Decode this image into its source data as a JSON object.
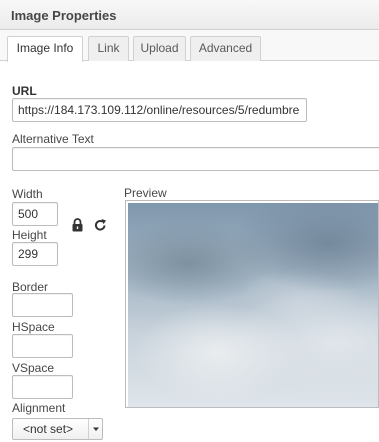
{
  "dialog": {
    "title": "Image Properties"
  },
  "tabs": [
    {
      "label": "Image Info",
      "active": true
    },
    {
      "label": "Link",
      "active": false
    },
    {
      "label": "Upload",
      "active": false
    },
    {
      "label": "Advanced",
      "active": false
    }
  ],
  "url": {
    "label": "URL",
    "value": "https://184.173.109.112/online/resources/5/redumbre"
  },
  "alt_text": {
    "label": "Alternative Text",
    "value": ""
  },
  "width": {
    "label": "Width",
    "value": "500"
  },
  "height": {
    "label": "Height",
    "value": "299"
  },
  "border": {
    "label": "Border",
    "value": ""
  },
  "hspace": {
    "label": "HSpace",
    "value": ""
  },
  "vspace": {
    "label": "VSpace",
    "value": ""
  },
  "alignment": {
    "label": "Alignment",
    "selected": "<not set>"
  },
  "preview": {
    "label": "Preview"
  },
  "icons": {
    "lock": "lock-icon",
    "reset": "reset-size-icon",
    "dropdown": "chevron-down-icon"
  },
  "colors": {
    "title_bar": "#ebebeb",
    "border": "#bcbcbc",
    "text": "#333333"
  }
}
